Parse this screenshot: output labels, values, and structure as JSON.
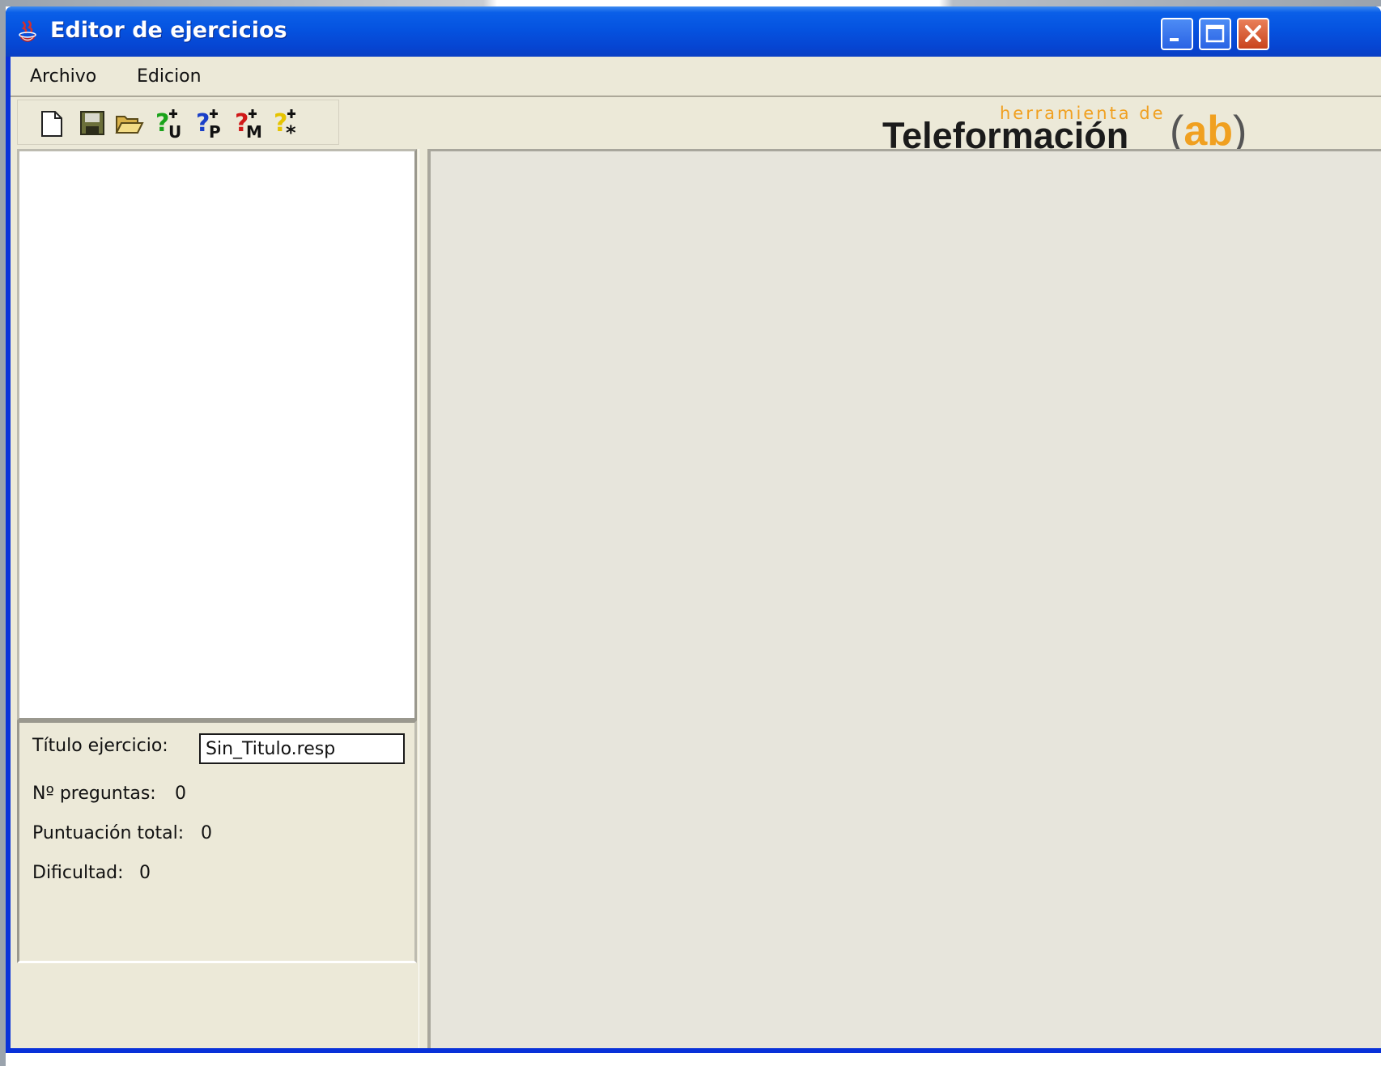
{
  "window": {
    "title": "Editor de ejercicios",
    "controls": [
      "minimize",
      "maximize",
      "close"
    ]
  },
  "menubar": {
    "items": [
      {
        "label": "Archivo"
      },
      {
        "label": "Edicion"
      }
    ]
  },
  "toolbar": {
    "tools": [
      {
        "icon": "new-document-icon"
      },
      {
        "icon": "save-icon"
      },
      {
        "icon": "open-folder-icon"
      },
      {
        "icon": "add-question-u-icon",
        "badge": "U",
        "color": "#1aa31a"
      },
      {
        "icon": "add-question-p-icon",
        "badge": "P",
        "color": "#1a3fc8"
      },
      {
        "icon": "add-question-m-icon",
        "badge": "M",
        "color": "#d01818"
      },
      {
        "icon": "add-question-star-icon",
        "badge": "*",
        "color": "#e6c400"
      }
    ]
  },
  "brand": {
    "tagline": "herramienta de",
    "name": "Teleformación",
    "mark_open": "(",
    "mark": "ab",
    "mark_close": ")",
    "accent_color": "#f0a020"
  },
  "info_panel": {
    "title_label": "Título ejercicio:",
    "title_value": "Sin_Titulo.resp",
    "questions_label": "Nº preguntas:",
    "questions_value": "0",
    "score_label": "Puntuación total:",
    "score_value": "0",
    "difficulty_label": "Dificultad:",
    "difficulty_value": "0"
  },
  "colors": {
    "titlebar": "#0553e0",
    "client_bg": "#ece9d8",
    "close_button": "#c9441d"
  }
}
